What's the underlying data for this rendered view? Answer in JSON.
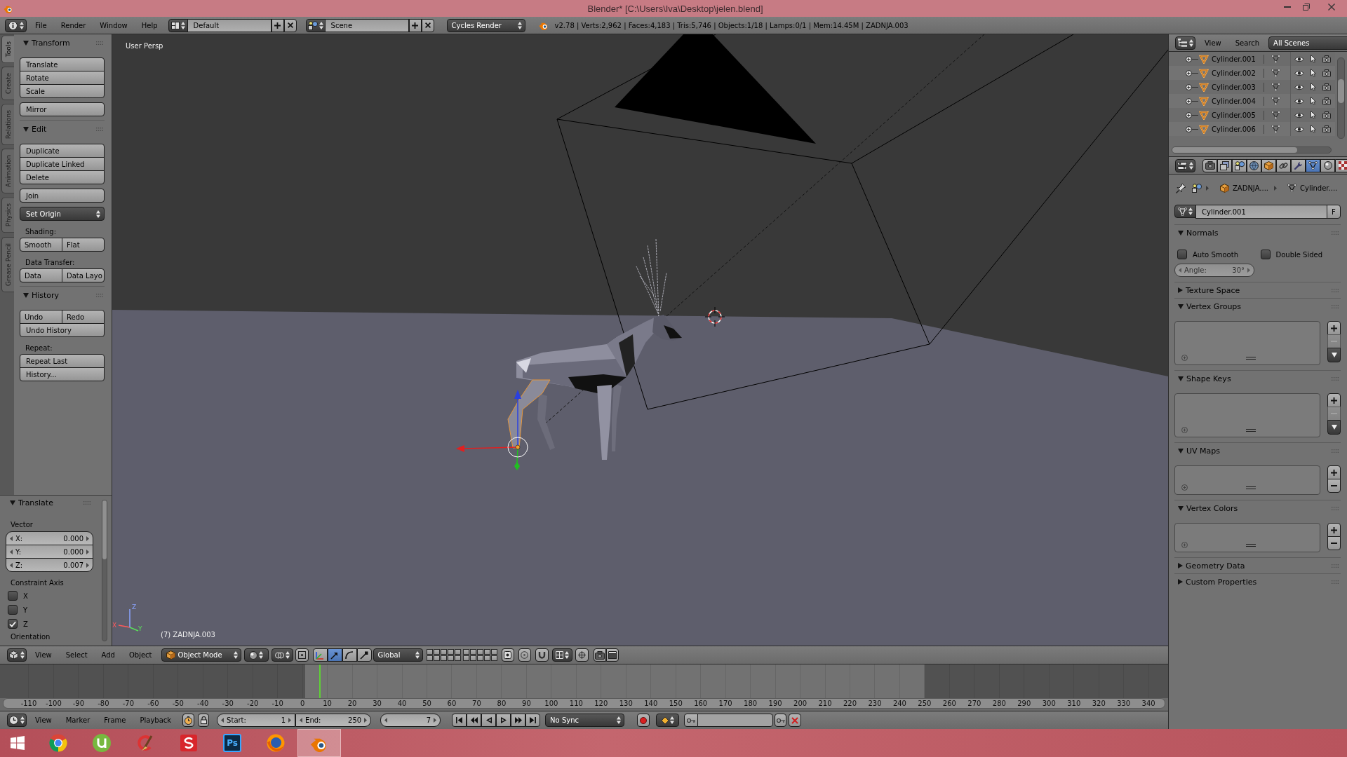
{
  "window": {
    "title": "Blender* [C:\\Users\\Iva\\Desktop\\jelen.blend]"
  },
  "info_header": {
    "menus": [
      "File",
      "Render",
      "Window",
      "Help"
    ],
    "layout": "Default",
    "scene": "Scene",
    "engine": "Cycles Render",
    "stats": "v2.78 | Verts:2,962 | Faces:4,183 | Tris:5,746 | Objects:1/18 | Lamps:0/1 | Mem:14.45M | ZADNJA.003"
  },
  "tool_tabs": [
    {
      "label": "Tools",
      "selected": true
    },
    {
      "label": "Create",
      "selected": false
    },
    {
      "label": "Relations",
      "selected": false
    },
    {
      "label": "Animation",
      "selected": false
    },
    {
      "label": "Physics",
      "selected": false
    },
    {
      "label": "Grease Pencil",
      "selected": false
    }
  ],
  "tool_shelf": [
    {
      "title": "Transform",
      "expanded": true,
      "items": [
        {
          "kind": "buttons",
          "rows": [
            [
              "Translate"
            ],
            [
              "Rotate"
            ],
            [
              "Scale"
            ]
          ]
        },
        {
          "kind": "buttons",
          "rows": [
            [
              "Mirror"
            ]
          ]
        }
      ]
    },
    {
      "title": "Edit",
      "expanded": true,
      "items": [
        {
          "kind": "buttons",
          "rows": [
            [
              "Duplicate"
            ],
            [
              "Duplicate Linked"
            ],
            [
              "Delete"
            ]
          ]
        },
        {
          "kind": "buttons",
          "rows": [
            [
              "Join"
            ]
          ]
        },
        {
          "kind": "dropdown",
          "label": "Set Origin"
        },
        {
          "kind": "label",
          "text": "Shading:"
        },
        {
          "kind": "buttons",
          "rows": [
            [
              "Smooth",
              "Flat"
            ]
          ]
        },
        {
          "kind": "label",
          "text": "Data Transfer:"
        },
        {
          "kind": "buttons",
          "rows": [
            [
              "Data",
              "Data Layo"
            ]
          ]
        }
      ]
    },
    {
      "title": "History",
      "expanded": true,
      "items": [
        {
          "kind": "buttons",
          "rows": [
            [
              "Undo",
              "Redo"
            ],
            [
              "Undo History"
            ]
          ]
        },
        {
          "kind": "label",
          "text": "Repeat:"
        },
        {
          "kind": "buttons",
          "rows": [
            [
              "Repeat Last"
            ],
            [
              "History..."
            ]
          ]
        }
      ]
    }
  ],
  "operator_panel": {
    "title": "Translate",
    "expanded": true,
    "vector_label": "Vector",
    "fields": [
      {
        "label": "X:",
        "value": "0.000"
      },
      {
        "label": "Y:",
        "value": "0.000"
      },
      {
        "label": "Z:",
        "value": "0.007"
      }
    ],
    "axis_label": "Constraint Axis",
    "axes": [
      {
        "label": "X",
        "checked": false
      },
      {
        "label": "Y",
        "checked": false
      },
      {
        "label": "Z",
        "checked": true
      }
    ],
    "next_label": "Orientation"
  },
  "viewport": {
    "view_name": "User Persp",
    "object_label": "(7) ZADNJA.003",
    "gizmo_axes": [
      "X",
      "Y",
      "Z"
    ]
  },
  "view_header": {
    "menus": [
      "View",
      "Select",
      "Add",
      "Object"
    ],
    "mode": "Object Mode",
    "manipulators": [
      {
        "kind": "axes",
        "selected": false
      },
      {
        "kind": "translate",
        "selected": true
      },
      {
        "kind": "rotate",
        "selected": false
      },
      {
        "kind": "scale",
        "selected": false
      }
    ],
    "orientation": "Global"
  },
  "timeline": {
    "ruler": [
      "-110",
      "-100",
      "-90",
      "-80",
      "-70",
      "-60",
      "-50",
      "-40",
      "-30",
      "-20",
      "-10",
      "0",
      "10",
      "20",
      "30",
      "40",
      "50",
      "60",
      "70",
      "80",
      "90",
      "100",
      "110",
      "120",
      "130",
      "140",
      "150",
      "160",
      "170",
      "180",
      "190",
      "200",
      "210",
      "220",
      "230",
      "240",
      "250",
      "260",
      "270",
      "280",
      "290",
      "300",
      "310",
      "320",
      "330",
      "340"
    ],
    "menus": [
      "View",
      "Marker",
      "Frame",
      "Playback"
    ],
    "start_label": "Start:",
    "start": "1",
    "end_label": "End:",
    "end": "250",
    "current_frame": "7",
    "sync": "No Sync"
  },
  "outliner": {
    "menus": [
      "View",
      "Search"
    ],
    "filter": "All Scenes",
    "rows": [
      {
        "name": "Cylinder.001"
      },
      {
        "name": "Cylinder.002"
      },
      {
        "name": "Cylinder.003"
      },
      {
        "name": "Cylinder.004"
      },
      {
        "name": "Cylinder.005"
      },
      {
        "name": "Cylinder.006"
      }
    ]
  },
  "properties": {
    "tabs": [
      {
        "kind": "render",
        "selected": false
      },
      {
        "kind": "render_layers",
        "selected": false
      },
      {
        "kind": "scene",
        "selected": false
      },
      {
        "kind": "world",
        "selected": false
      },
      {
        "kind": "object",
        "selected": false
      },
      {
        "kind": "constraints",
        "selected": false
      },
      {
        "kind": "modifiers",
        "selected": false
      },
      {
        "kind": "data",
        "selected": true
      },
      {
        "kind": "material",
        "selected": false
      },
      {
        "kind": "texture",
        "selected": false
      }
    ],
    "breadcrumb": [
      "ZADNJA....",
      "Cylinder...."
    ],
    "datablock": {
      "name": "Cylinder.001",
      "fake_user": "F"
    },
    "panels": [
      {
        "kind": "normals",
        "title": "Normals",
        "expanded": true,
        "checks": [
          {
            "label": "Auto Smooth",
            "checked": false
          },
          {
            "label": "Double Sided",
            "checked": false
          }
        ],
        "angle": {
          "label": "Angle:",
          "value": "30°",
          "disabled": true
        }
      },
      {
        "kind": "plain",
        "title": "Texture Space",
        "expanded": false
      },
      {
        "kind": "list",
        "title": "Vertex Groups",
        "expanded": true,
        "remove_disabled": true,
        "specials": true
      },
      {
        "kind": "list",
        "title": "Shape Keys",
        "expanded": true,
        "remove_disabled": true,
        "specials": true
      },
      {
        "kind": "list",
        "title": "UV Maps",
        "expanded": true,
        "remove_disabled": false,
        "specials": false
      },
      {
        "kind": "list",
        "title": "Vertex Colors",
        "expanded": true,
        "remove_disabled": false,
        "specials": false
      },
      {
        "kind": "plain",
        "title": "Geometry Data",
        "expanded": false
      },
      {
        "kind": "plain",
        "title": "Custom Properties",
        "expanded": false
      }
    ]
  },
  "taskbar": [
    {
      "kind": "start",
      "selected": false
    },
    {
      "kind": "chrome",
      "selected": false
    },
    {
      "kind": "utorrent",
      "selected": false
    },
    {
      "kind": "ccleaner",
      "selected": false
    },
    {
      "kind": "sketch",
      "selected": false
    },
    {
      "kind": "photoshop",
      "label": "Ps",
      "selected": false
    },
    {
      "kind": "firefox",
      "selected": false
    },
    {
      "kind": "blender",
      "selected": true
    }
  ]
}
